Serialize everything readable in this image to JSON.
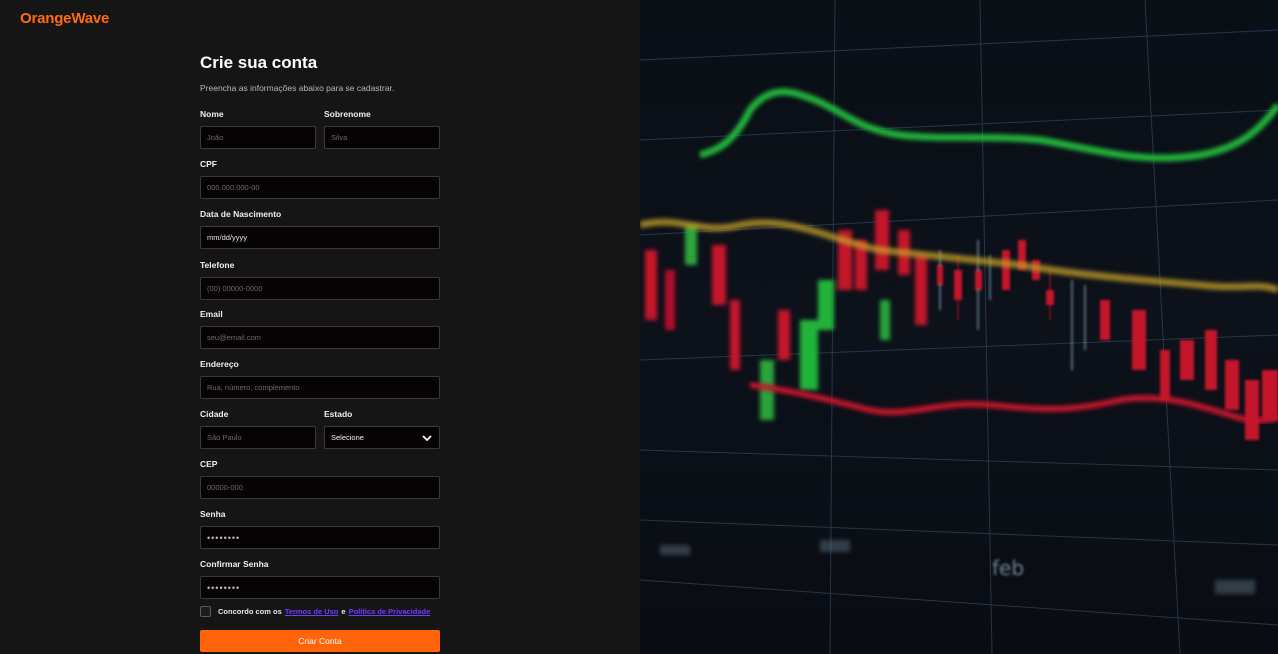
{
  "brand": "OrangeWave",
  "form": {
    "title": "Crie sua conta",
    "subtitle": "Preencha as informações abaixo para se cadastrar.",
    "nome": {
      "label": "Nome",
      "placeholder": "João"
    },
    "sobrenome": {
      "label": "Sobrenome",
      "placeholder": "Silva"
    },
    "cpf": {
      "label": "CPF",
      "placeholder": "000.000.000-00"
    },
    "nascimento": {
      "label": "Data de Nascimento",
      "value": "mm/dd/yyyy"
    },
    "telefone": {
      "label": "Telefone",
      "placeholder": "(00) 00000-0000"
    },
    "email": {
      "label": "Email",
      "placeholder": "seu@email.com"
    },
    "endereco": {
      "label": "Endereço",
      "placeholder": "Rua, número, complemento"
    },
    "cidade": {
      "label": "Cidade",
      "placeholder": "São Paulo"
    },
    "estado": {
      "label": "Estado",
      "selected": "Selecione"
    },
    "cep": {
      "label": "CEP",
      "placeholder": "00000-000"
    },
    "senha": {
      "label": "Senha",
      "value": "••••••••"
    },
    "confirmar": {
      "label": "Confirmar Senha",
      "value": "••••••••"
    },
    "agree": {
      "prefix": "Concordo com os",
      "terms": "Termos de Uso",
      "and": "e",
      "privacy": "Política de Privacidade"
    },
    "submit": "Criar Conta"
  },
  "hero": {
    "axis_labels": [
      "feb"
    ],
    "colors": {
      "green": "#22b33a",
      "red": "#c4122a",
      "yellow": "#c8a12a",
      "grid": "#3d6a8a"
    }
  }
}
